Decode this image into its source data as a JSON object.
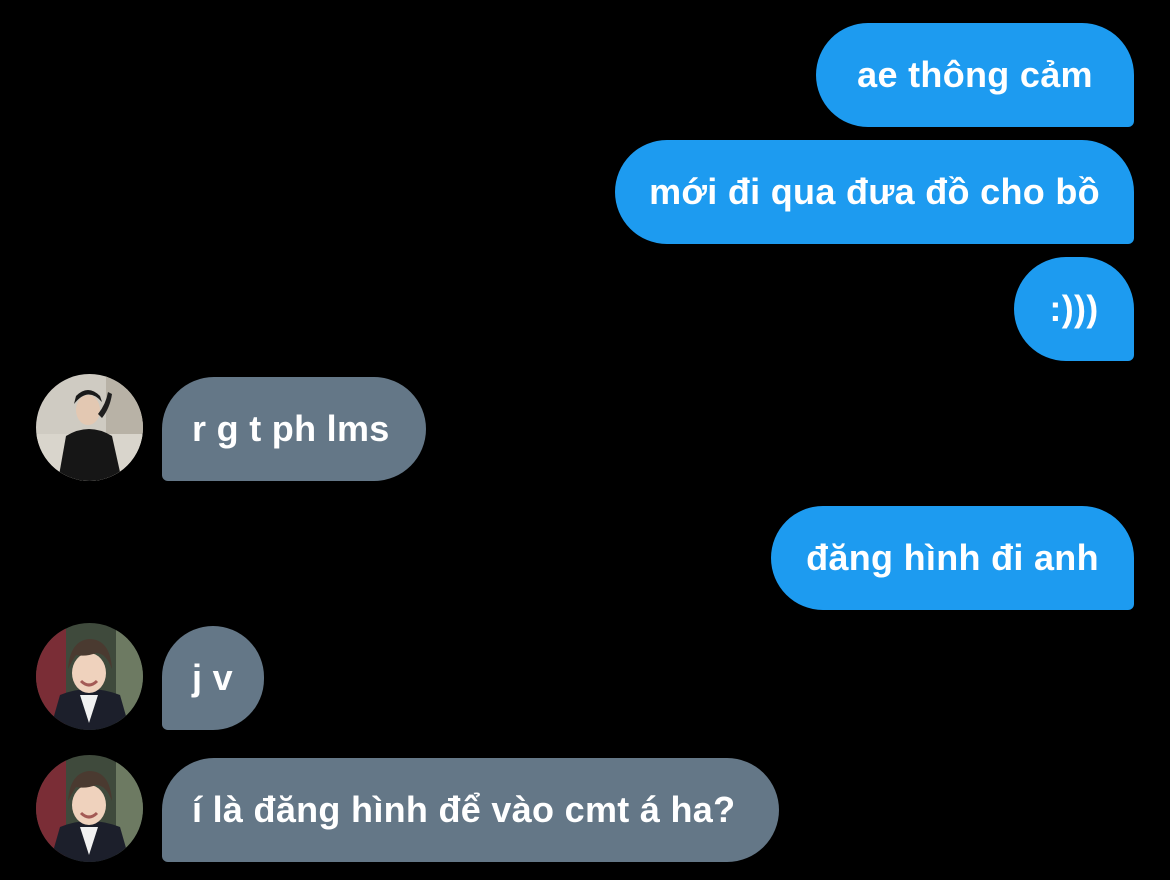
{
  "conversation": {
    "messages": [
      {
        "sender": "me",
        "text": "ae thông cảm"
      },
      {
        "sender": "me",
        "text": "mới đi qua đưa đồ cho bồ"
      },
      {
        "sender": "me",
        "text": ":)))"
      },
      {
        "sender": "other",
        "text": "r g t ph lms"
      },
      {
        "sender": "me",
        "text": "đăng hình đi anh"
      },
      {
        "sender": "other",
        "text": "j v"
      },
      {
        "sender": "other",
        "text": "í là đăng hình để vào cmt á ha?"
      }
    ]
  },
  "colors": {
    "background": "#000000",
    "outgoing_bubble": "#1d9bf0",
    "incoming_bubble": "#647787",
    "text": "#ffffff"
  },
  "icons": {
    "avatar_1": "profile-photo-dark-jacket",
    "avatar_2": "profile-photo-hanbok-smiling"
  }
}
